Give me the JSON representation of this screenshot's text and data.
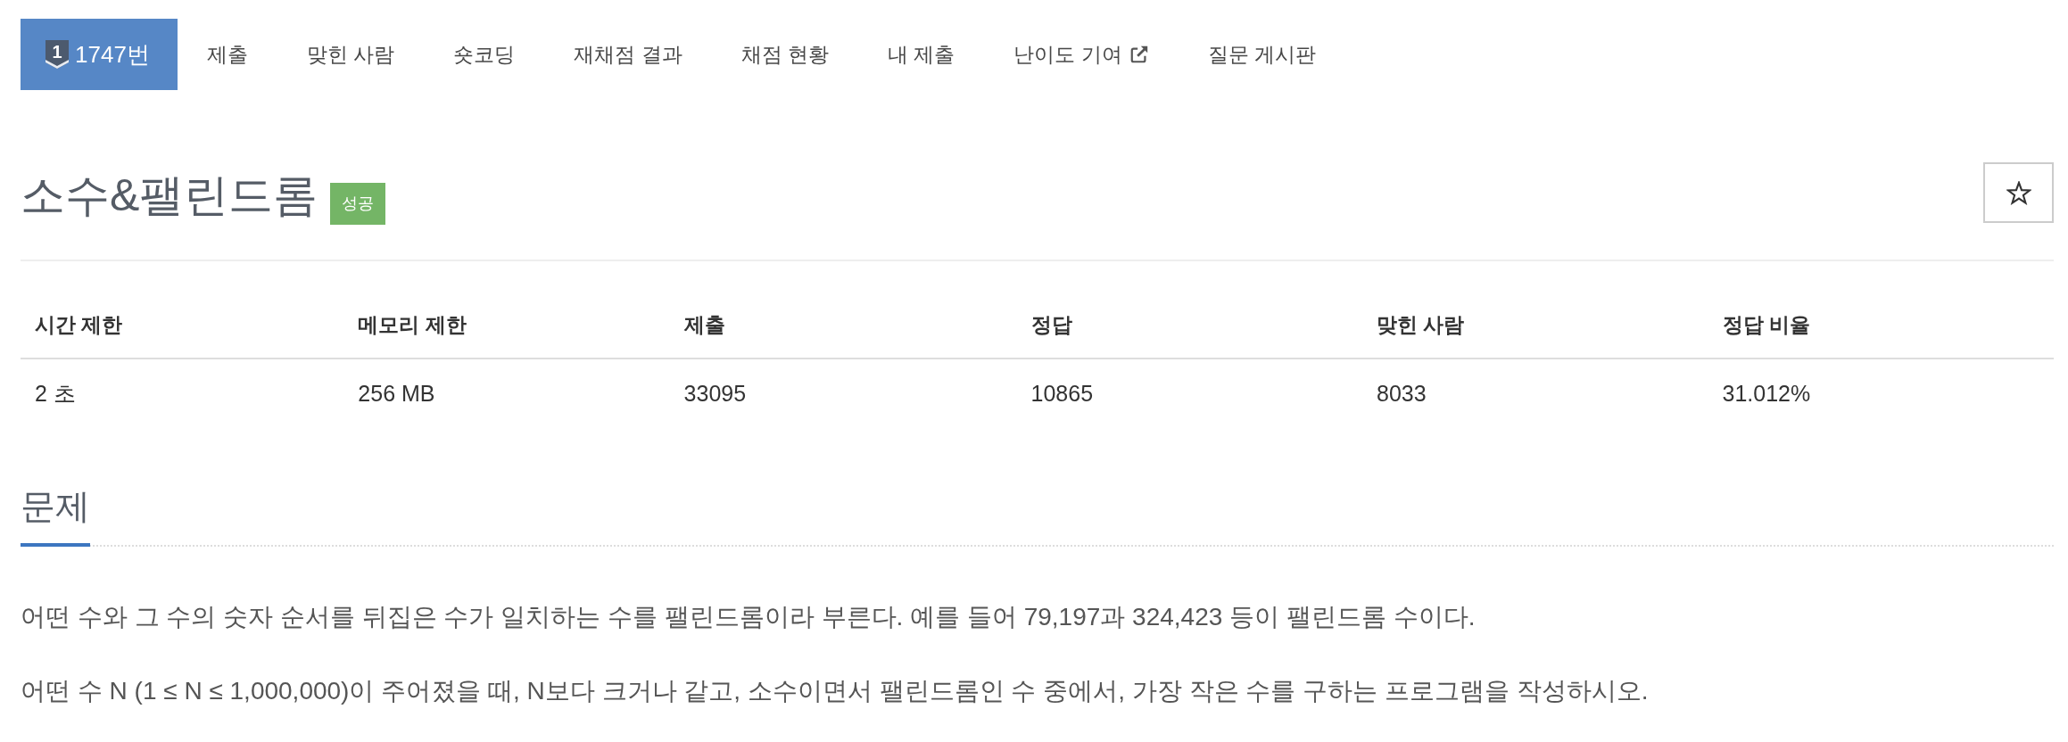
{
  "nav": {
    "tabs": [
      {
        "label": "1747번",
        "badge": "1",
        "selected": true,
        "external": false
      },
      {
        "label": "제출",
        "selected": false,
        "external": false
      },
      {
        "label": "맞힌 사람",
        "selected": false,
        "external": false
      },
      {
        "label": "숏코딩",
        "selected": false,
        "external": false
      },
      {
        "label": "재채점 결과",
        "selected": false,
        "external": false
      },
      {
        "label": "채점 현황",
        "selected": false,
        "external": false
      },
      {
        "label": "내 제출",
        "selected": false,
        "external": false
      },
      {
        "label": "난이도 기여",
        "selected": false,
        "external": true
      },
      {
        "label": "질문 게시판",
        "selected": false,
        "external": false
      }
    ]
  },
  "problem": {
    "title": "소수&팰린드롬",
    "status": {
      "label": "성공",
      "kind": "success"
    },
    "starred": false
  },
  "stats": {
    "columns": [
      "시간 제한",
      "메모리 제한",
      "제출",
      "정답",
      "맞힌 사람",
      "정답 비율"
    ],
    "rows": [
      [
        "2 초",
        "256 MB",
        "33095",
        "10865",
        "8033",
        "31.012%"
      ]
    ]
  },
  "section": {
    "heading": "문제",
    "paragraphs": [
      "어떤 수와 그 수의 숫자 순서를 뒤집은 수가 일치하는 수를 팰린드롬이라 부른다. 예를 들어 79,197과 324,423 등이 팰린드롬 수이다.",
      "어떤 수 N (1 ≤ N ≤ 1,000,000)이 주어졌을 때, N보다 크거나 같고, 소수이면서 팰린드롬인 수 중에서, 가장 작은 수를 구하는 프로그램을 작성하시오."
    ]
  }
}
